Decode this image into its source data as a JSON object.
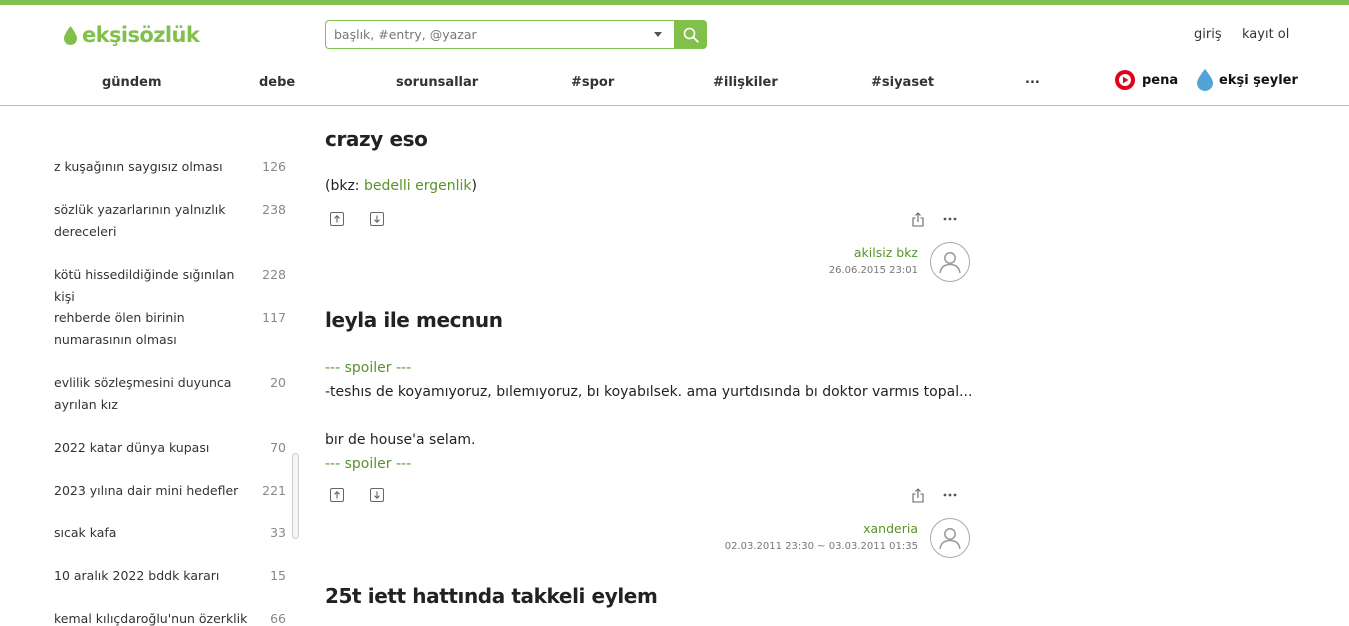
{
  "header": {
    "logo": {
      "part1": "ekşi",
      "part2": "sözlük"
    },
    "search": {
      "placeholder": "başlık, #entry, @yazar"
    },
    "auth": {
      "login": "giriş",
      "register": "kayıt ol"
    }
  },
  "nav": {
    "items": [
      "gündem",
      "debe",
      "sorunsallar",
      "#spor",
      "#ilişkiler",
      "#siyaset",
      "..."
    ],
    "brands": [
      {
        "label": "pena",
        "icon": "pena-play-icon",
        "color": "#e3001b"
      },
      {
        "label": "ekşi şeyler",
        "icon": "water-drop-icon",
        "color": "#53a3d9"
      }
    ]
  },
  "sidebar": {
    "topics": [
      {
        "title": "z kuşağının saygısız olması",
        "count": "126"
      },
      {
        "title": "sözlük yazarlarının yalnızlık dereceleri",
        "count": "238"
      },
      {
        "title": "kötü hissedildiğinde sığınılan kişi",
        "count": "228"
      },
      {
        "title": "rehberde ölen birinin numarasının olması",
        "count": "117"
      },
      {
        "title": "evlilik sözleşmesini duyunca ayrılan kız",
        "count": "20"
      },
      {
        "title": "2022 katar dünya kupası",
        "count": "70"
      },
      {
        "title": "2023 yılına dair mini hedefler",
        "count": "221"
      },
      {
        "title": "sıcak kafa",
        "count": "33"
      },
      {
        "title": "10 aralık 2022 bddk kararı",
        "count": "15"
      },
      {
        "title": "kemal kılıçdaroğlu'nun özerklik",
        "count": "66"
      }
    ]
  },
  "entries": [
    {
      "title": "crazy eso",
      "bkz_prefix": "(bkz: ",
      "bkz_link": "bedelli ergenlik",
      "bkz_suffix": ")",
      "author": "akilsiz bkz",
      "date": "26.06.2015 23:01"
    },
    {
      "title": "leyla ile mecnun",
      "spoiler_dashes": "---",
      "spoiler_label": "spoiler",
      "line1": "-teshıs de koyamıyoruz, bılemıyoruz, bı koyabılsek. ama yurtdısında bı doktor varmıs topal...",
      "line2": "bır de house'a selam.",
      "author": "xanderia",
      "date": "02.03.2011 23:30 ~ 03.03.2011 01:35"
    },
    {
      "title": "25t iett hattında takkeli eylem"
    }
  ],
  "colors": {
    "brand_green": "#81c14b",
    "link_green": "#59932b"
  }
}
